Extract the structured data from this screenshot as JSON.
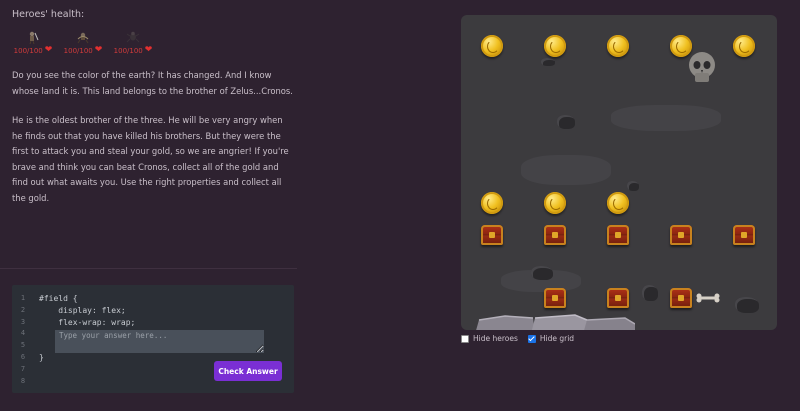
{
  "heroes": {
    "title": "Heroes' health:",
    "items": [
      {
        "health": "100/100",
        "icon": "warrior-hero-icon"
      },
      {
        "health": "100/100",
        "icon": "archer-hero-icon"
      },
      {
        "health": "100/100",
        "icon": "spider-hero-icon"
      }
    ]
  },
  "story": {
    "paragraph_1": "Do you see the color of the earth? It has changed. And I know whose land it is. This land belongs to the brother of Zelus...Cronos.",
    "paragraph_2": "He is the oldest brother of the three. He will be very angry when he finds out that you have killed his brothers. But they were the first to attack you and steal your gold, so we are angrier! If you're brave and think you can beat Cronos, collect all of the gold and find out what awaits you. Use the right properties and collect all the gold."
  },
  "editor": {
    "line_numbers": [
      "1",
      "2",
      "3",
      "4",
      "5",
      "6",
      "7",
      "8"
    ],
    "code_lines": [
      "#field {",
      "    display: flex;",
      "    flex-wrap: wrap;",
      "",
      "",
      "}"
    ],
    "answer_placeholder": "Type your answer here...",
    "answer_value": "",
    "check_button_label": "Check Answer"
  },
  "options": {
    "hide_heroes_label": "Hide heroes",
    "hide_heroes_checked": false,
    "hide_grid_label": "Hide grid",
    "hide_grid_checked": true
  },
  "colors": {
    "background": "#2e2230",
    "field": "#3c3b3e",
    "accent_button": "#7a2fd4",
    "health_red": "#d23b3b"
  }
}
